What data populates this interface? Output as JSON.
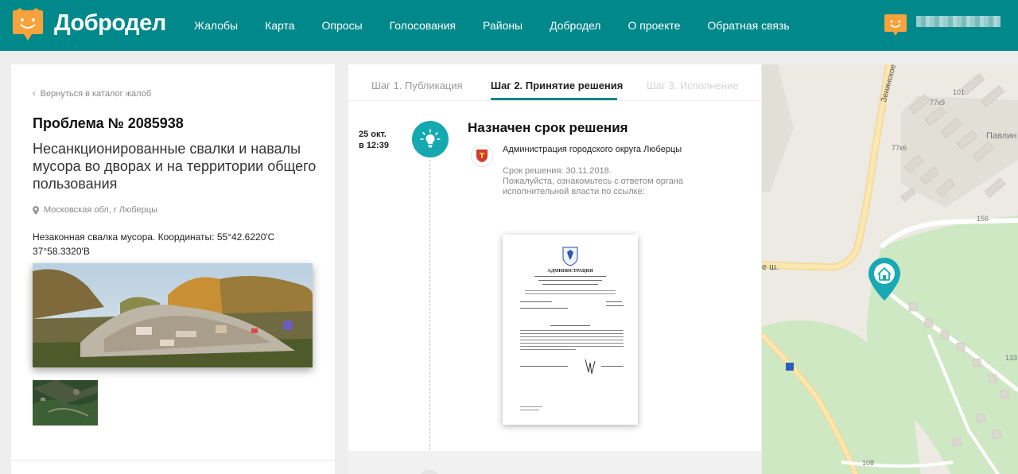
{
  "header": {
    "logo_text": "Добродел",
    "nav": [
      "Жалобы",
      "Карта",
      "Опросы",
      "Голосования",
      "Районы",
      "Добродел",
      "О проекте",
      "Обратная связь"
    ],
    "brand_color": "#00888a"
  },
  "left": {
    "back_link": "Вернуться в каталог жалоб",
    "problem_title": "Проблема № 2085938",
    "problem_subtitle": "Несанкционированные свалки и навалы мусора во дворах и на территории общего пользования",
    "location": "Московская обл, г Люберцы",
    "description": "Незаконная свалка мусора. Координаты: 55°42.6220'С 37°58.3320'В"
  },
  "steps": {
    "tabs": [
      "Шаг 1. Публикация",
      "Шаг 2. Принятие решения",
      "Шаг 3. Исполнение"
    ],
    "active_index": 1
  },
  "event": {
    "date": "25 окт.",
    "time": "в 12:39",
    "title": "Назначен срок решения",
    "org": "Администрация городского округа Люберцы",
    "deadline": "Срок решения: 30.11.2018.",
    "note": "Пожалуйста, ознакомьтесь с ответом органа исполнительной власти по ссылке:",
    "icon": "lightbulb-icon",
    "icon_color": "#14a9b0"
  },
  "document": {
    "title": "АДМИНИСТРАЦИЯ"
  },
  "map": {
    "street": "Зенинское",
    "labels": [
      "101",
      "77к9",
      "Павлин",
      "77к6",
      "156",
      "133",
      "108"
    ],
    "road_label": "е ш.",
    "marker_icon": "home-icon",
    "marker_color": "#18a9b4"
  }
}
